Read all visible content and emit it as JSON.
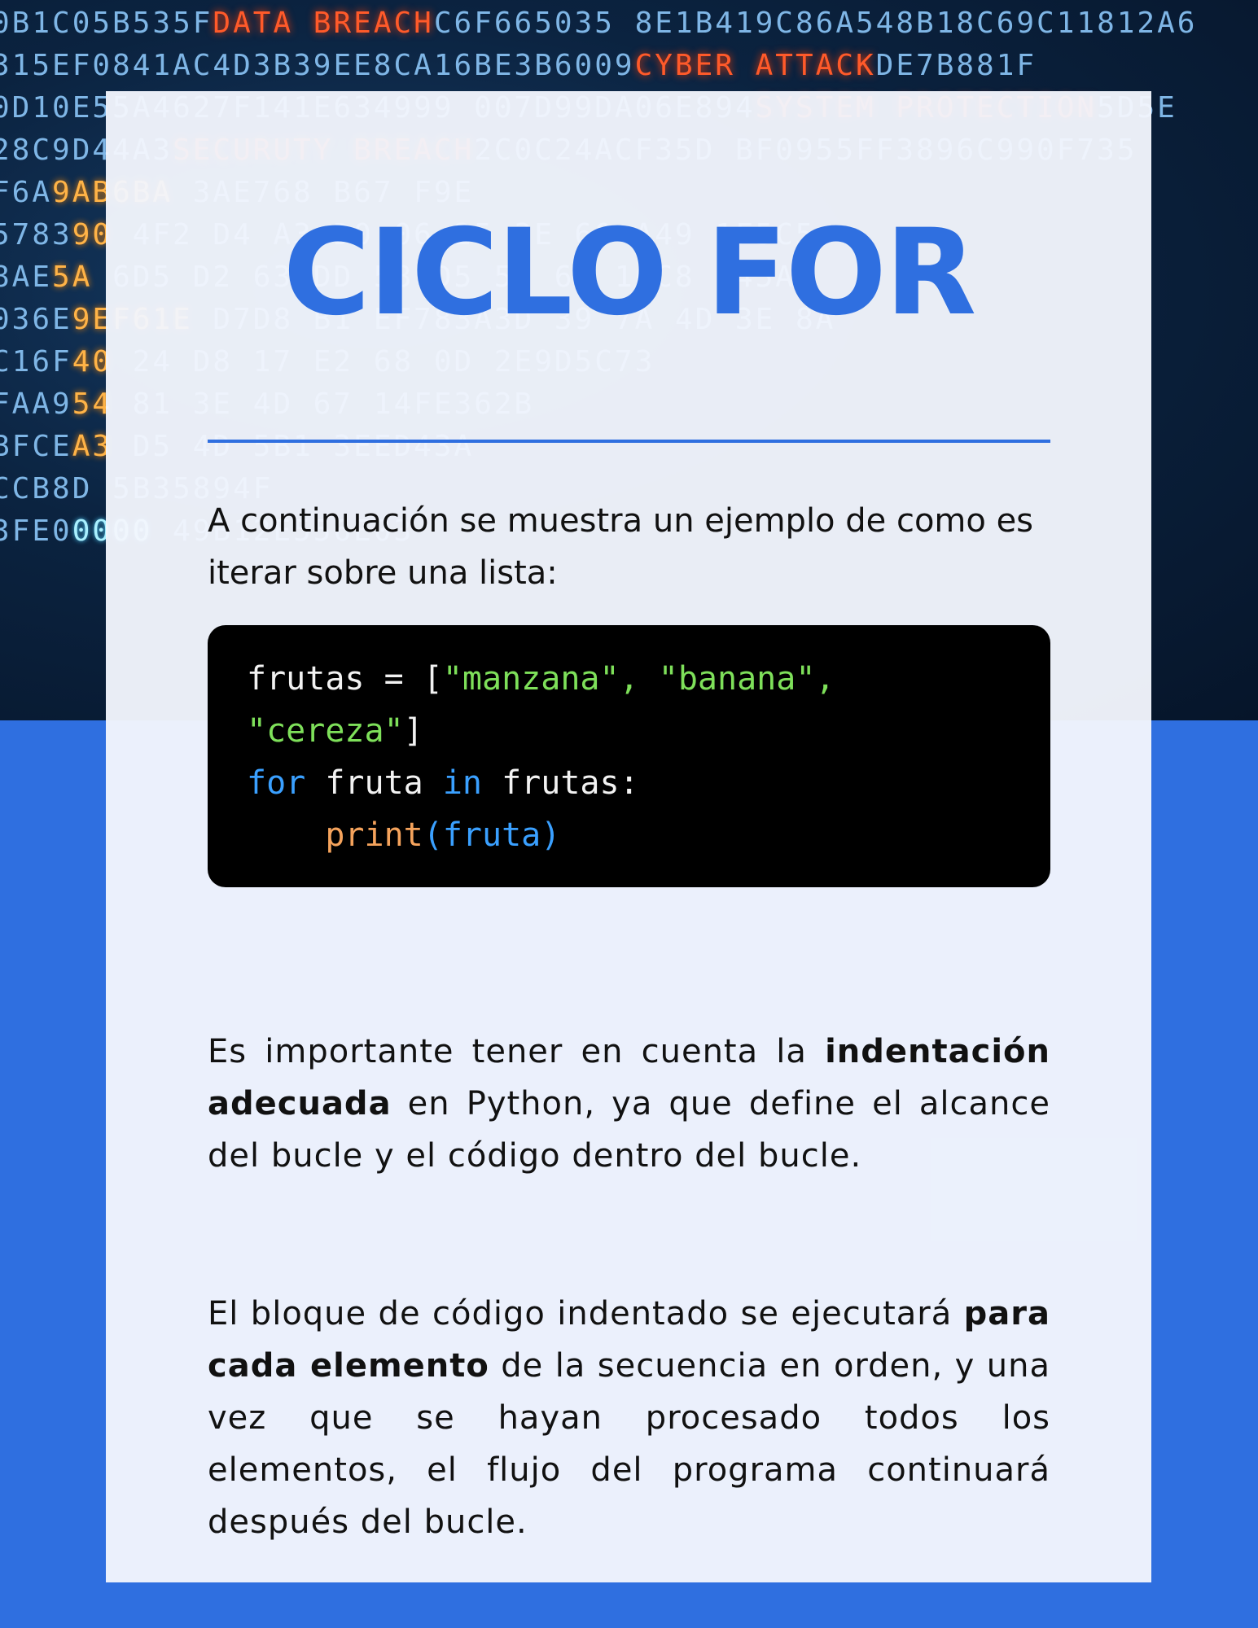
{
  "background": {
    "lines": [
      {
        "pre": "0B1C05B535F",
        "hl": "DATA BREACH",
        "post": "C6F665035 8E1B419C86A548B18C69C11812A6"
      },
      {
        "pre": "315EF0841AC4D3",
        "hl": "",
        "post": "B39EE8CA16BE3B6009",
        "hl2": "CYBER ATTACK",
        "post2": "DE7B881F"
      },
      {
        "pre": "0D10E55A46",
        "hl": "",
        "post": "27F141E634999  007D99DA06E894",
        "hl2": "SYSTEM PROTECTION",
        "post2": "5D5E"
      },
      {
        "pre": "28C9D44A3",
        "hl": "SECURUTY BREACH",
        "post": "2C0C24ACF35D  BF0955FF3896C990F735"
      },
      {
        "pre": "F6A",
        "amber": "9AB6BA",
        "post": "                                 3AE768  B67  F9E"
      },
      {
        "pre": "5783",
        "amber": "90",
        "post": "  4F2  D4  A3  D0  06  25  3E  60  A49 1F5C5"
      },
      {
        "pre": "8AE",
        "amber": "5A",
        "post": "  6D5  D2  63  DD  58  D5  53  6D  10C8 B45A"
      },
      {
        "pre": "036E",
        "amber": "9EF61E",
        "post": "  D7D8  B1  EF783A3D  39  7A  4D 3E 8A"
      },
      {
        "pre": "C16F",
        "amber": "40",
        "post": "  24  D8  17  E2  68  0D  2E9D5C73"
      },
      {
        "pre": "FAA9",
        "amber": "54",
        "post": "  81  3E  4D  67  14FE362B"
      },
      {
        "pre": "BFCE",
        "amber": "A3",
        "post": "  D5  4D  5B1  3EED43A"
      },
      {
        "pre": "CCB8D",
        "amber": "",
        "post": "  5B35894F"
      },
      {
        "pre": "3FE0",
        "cyan": "0000",
        "post": "  49B12E556E03"
      }
    ]
  },
  "title": "CICLO FOR",
  "intro": "A continuación se muestra un ejemplo de como es iterar sobre una lista:",
  "code": {
    "line1_a": "frutas = [",
    "line1_s1": "\"manzana\"",
    "line1_c1": ", ",
    "line1_s2": "\"banana\"",
    "line1_c2": ",",
    "line2_s3": "\"cereza\"",
    "line2_end": "]",
    "line3_kw1": "for",
    "line3_mid": " fruta ",
    "line3_kw2": "in",
    "line3_end": " frutas:",
    "line4_indent": "    ",
    "line4_fn": "print",
    "line4_arg": "(fruta)"
  },
  "paragraph1": {
    "t1": "Es importante tener en cuenta la ",
    "bold": "indentación adecuada",
    "t2": " en Python, ya que define el alcance del bucle y el código dentro del bucle."
  },
  "paragraph2": {
    "t1": "El bloque de código indentado se ejecutará ",
    "bold": "para cada elemento",
    "t2": " de la secuencia en orden, y una vez que se hayan procesado todos los elementos, el flujo del programa continuará después del bucle."
  },
  "colors": {
    "accent": "#2f6fe0",
    "card": "#f3f6fd",
    "code_bg": "#000000",
    "string": "#7ee05a",
    "keyword": "#3aa0ff",
    "function": "#f5a35c"
  }
}
